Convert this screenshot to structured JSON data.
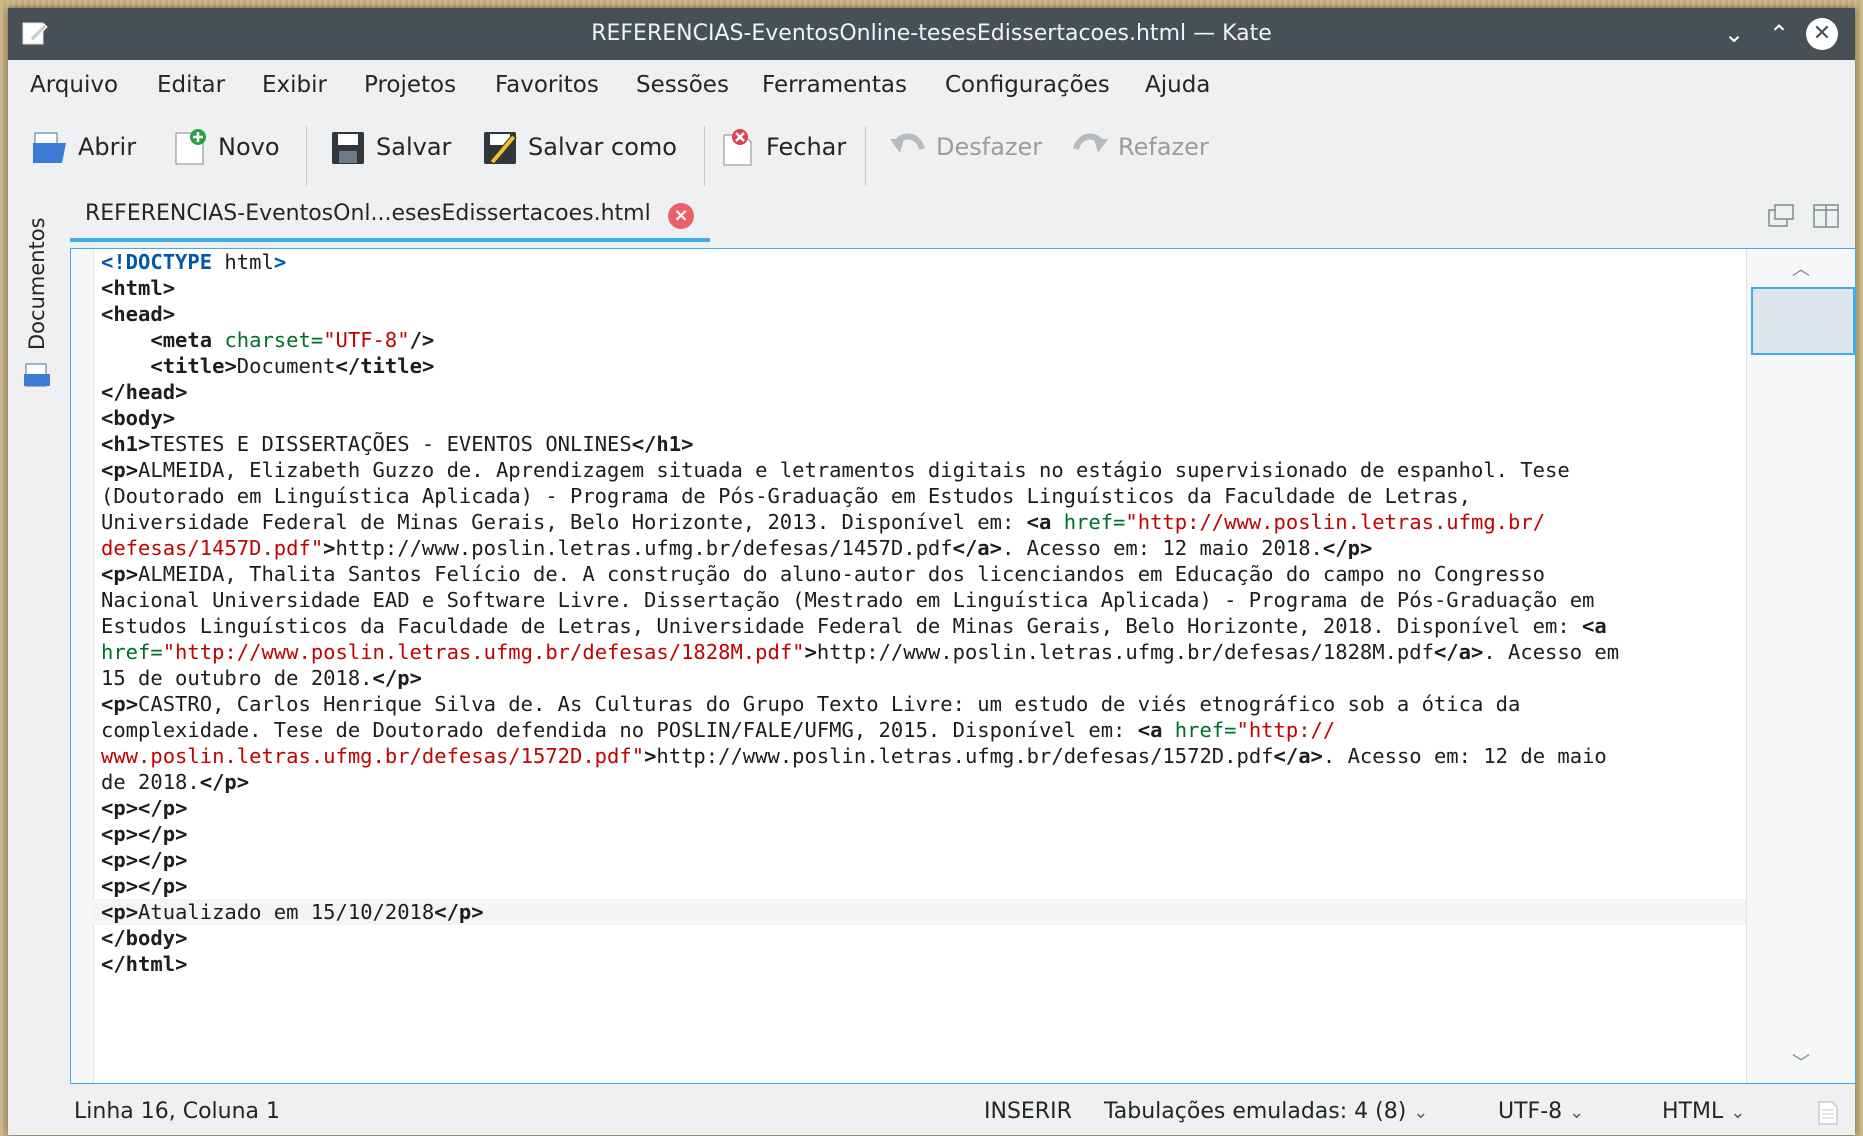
{
  "window": {
    "title": "REFERENCIAS-EventosOnline-tesesEdissertacoes.html — Kate"
  },
  "menu": [
    "Arquivo",
    "Editar",
    "Exibir",
    "Projetos",
    "Favoritos",
    "Sessões",
    "Ferramentas",
    "Configurações",
    "Ajuda"
  ],
  "toolbar": {
    "open": "Abrir",
    "new": "Novo",
    "save": "Salvar",
    "save_as": "Salvar como",
    "close": "Fechar",
    "undo": "Desfazer",
    "redo": "Refazer"
  },
  "sidebar": {
    "documents_label": "Documentos"
  },
  "tab": {
    "label": "REFERENCIAS-EventosOnl...esesEdissertacoes.html"
  },
  "code_lines": [
    "<!DOCTYPE html>",
    "<html>",
    "<head>",
    "    <meta charset=\"UTF-8\"/>",
    "    <title>Document</title>",
    "</head>",
    "<body>",
    "<h1>TESTES E DISSERTAÇÕES - EVENTOS ONLINES</h1>",
    "<p>ALMEIDA, Elizabeth Guzzo de. Aprendizagem situada e letramentos digitais no estágio supervisionado de espanhol. Tese",
    "(Doutorado em Linguística Aplicada) - Programa de Pós-Graduação em Estudos Linguísticos da Faculdade de Letras,",
    "Universidade Federal de Minas Gerais, Belo Horizonte, 2013. Disponível em: <a href=\"http://www.poslin.letras.ufmg.br/",
    "defesas/1457D.pdf\">http://www.poslin.letras.ufmg.br/defesas/1457D.pdf</a>. Acesso em: 12 maio 2018.</p>",
    "<p>ALMEIDA, Thalita Santos Felício de. A construção do aluno-autor dos licenciandos em Educação do campo no Congresso",
    "Nacional Universidade EAD e Software Livre. Dissertação (Mestrado em Linguística Aplicada) - Programa de Pós-Graduação em",
    "Estudos Linguísticos da Faculdade de Letras, Universidade Federal de Minas Gerais, Belo Horizonte, 2018. Disponível em: <a",
    "href=\"http://www.poslin.letras.ufmg.br/defesas/1828M.pdf\">http://www.poslin.letras.ufmg.br/defesas/1828M.pdf</a>. Acesso em",
    "15 de outubro de 2018.</p>",
    "<p>CASTRO, Carlos Henrique Silva de. As Culturas do Grupo Texto Livre: um estudo de viés etnográfico sob a ótica da",
    "complexidade. Tese de Doutorado defendida no POSLIN/FALE/UFMG, 2015. Disponível em: <a href=\"http://",
    "www.poslin.letras.ufmg.br/defesas/1572D.pdf\">http://www.poslin.letras.ufmg.br/defesas/1572D.pdf</a>. Acesso em: 12 de maio",
    "de 2018.</p>",
    "<p></p>",
    "<p></p>",
    "<p></p>",
    "<p></p>",
    "<p>Atualizado em 15/10/2018</p>",
    "</body>",
    "</html>"
  ],
  "current_line_index": 25,
  "status": {
    "cursor": "Linha 16, Coluna 1",
    "mode": "INSERIR",
    "indent": "Tabulações emuladas: 4 (8)",
    "encoding": "UTF-8",
    "syntax": "HTML"
  },
  "colors": {
    "accent": "#3daee9",
    "titlebar": "#475057",
    "tag_color": "#1f1c1b",
    "attr_color": "#006e28",
    "value_color": "#bf0303",
    "doctype_color": "#0057ae"
  }
}
